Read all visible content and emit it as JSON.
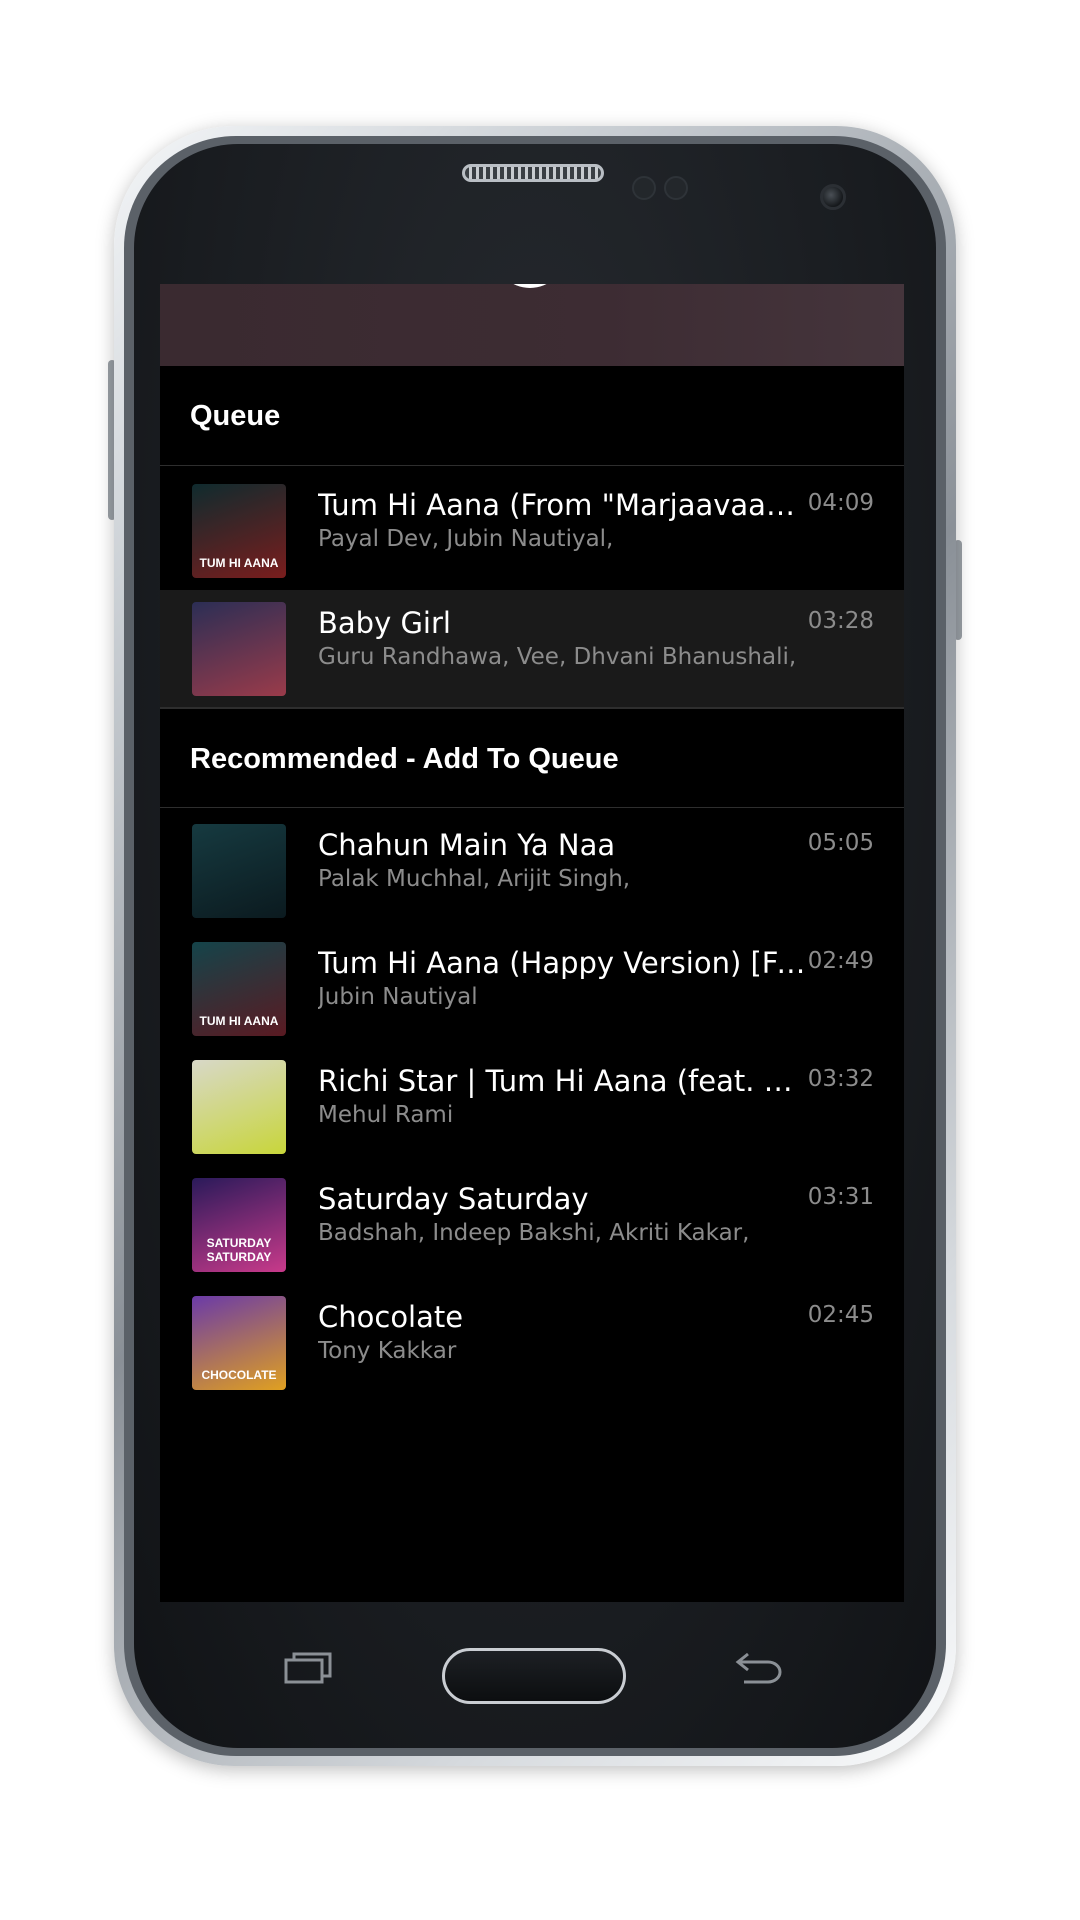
{
  "sections": {
    "queue_title": "Queue",
    "recommended_title": "Recommended - Add To Queue"
  },
  "queue": [
    {
      "title": "Tum Hi Aana (From \"Marjaavaan\")",
      "artist": "Payal Dev, Jubin Nautiyal,",
      "duration": "04:09",
      "thumb_text": "TUM HI AANA",
      "thumb_colors": [
        "#0f2b2e",
        "#7a1d1d"
      ]
    },
    {
      "title": "Baby Girl",
      "artist": "Guru Randhawa, Vee, Dhvani Bhanushali,",
      "duration": "03:28",
      "thumb_text": "",
      "thumb_colors": [
        "#2b2e55",
        "#9a3b4a"
      ]
    }
  ],
  "recommended": [
    {
      "title": "Chahun Main Ya Naa",
      "artist": "Palak Muchhal, Arijit Singh,",
      "duration": "05:05",
      "thumb_text": "",
      "thumb_colors": [
        "#163a40",
        "#0b1a1f"
      ]
    },
    {
      "title": "Tum Hi Aana (Happy Version) [From \"Marjaavaan\"]",
      "artist": "Jubin Nautiyal",
      "duration": "02:49",
      "thumb_text": "TUM HI AANA",
      "thumb_colors": [
        "#14444a",
        "#5a1a22"
      ]
    },
    {
      "title": "Richi Star | Tum Hi Aana (feat. Richi Star)",
      "artist": "Mehul Rami",
      "duration": "03:32",
      "thumb_text": "",
      "thumb_colors": [
        "#d8d8c8",
        "#c8d63a"
      ]
    },
    {
      "title": "Saturday Saturday",
      "artist": "Badshah, Indeep Bakshi, Akriti Kakar,",
      "duration": "03:31",
      "thumb_text": "SATURDAY SATURDAY",
      "thumb_colors": [
        "#2a1a5a",
        "#c83a8a"
      ]
    },
    {
      "title": "Chocolate",
      "artist": "Tony Kakkar",
      "duration": "02:45",
      "thumb_text": "CHOCOLATE",
      "thumb_colors": [
        "#6a3aa8",
        "#e0a020"
      ]
    }
  ],
  "icons": {
    "recent_apps": "recent-apps-icon",
    "home": "home-button",
    "back": "back-icon"
  },
  "colors": {
    "screen_bg": "#000000",
    "highlight_row": "#1a1a1a",
    "secondary_text": "#8c8c8c",
    "top_strip": "#3d2c33"
  }
}
